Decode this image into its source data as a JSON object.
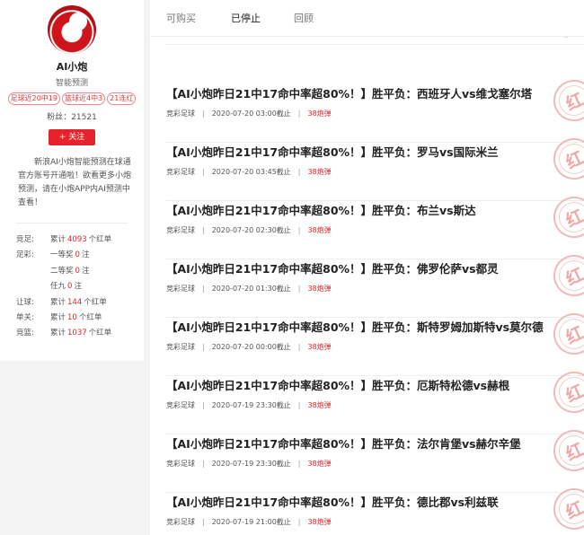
{
  "profile": {
    "name": "AI小炮",
    "subtitle": "智能预测",
    "badges": [
      "足球近20中19",
      "篮球近4中3",
      "21连红"
    ],
    "fans_label": "粉丝：",
    "fans": "21521",
    "follow_label": "+ 关注",
    "description": "新浪AI小炮智能预测在球通官方账号开通啦！欲看更多小炮预测，请在小炮APP内AI预测中查看！",
    "stats": [
      {
        "label": "竞足:",
        "prefix": "累计",
        "value": "4093",
        "suffix": "个红单"
      },
      {
        "label": "足彩:",
        "prefix": "一等奖",
        "value": "0",
        "suffix": "注"
      },
      {
        "label": "",
        "prefix": "二等奖",
        "value": "0",
        "suffix": "注"
      },
      {
        "label": "",
        "prefix": "任九",
        "value": "0",
        "suffix": "注"
      },
      {
        "label": "让球:",
        "prefix": "累计",
        "value": "144",
        "suffix": "个红单"
      },
      {
        "label": "单关:",
        "prefix": "累计",
        "value": "10",
        "suffix": "个红单"
      },
      {
        "label": "竞篮:",
        "prefix": "累计",
        "value": "1037",
        "suffix": "个红单"
      }
    ]
  },
  "tabs": [
    {
      "label": "可购买",
      "active": false
    },
    {
      "label": "已停止",
      "active": true
    },
    {
      "label": "回顾",
      "active": false
    }
  ],
  "stamp_text": "红",
  "items": [
    {
      "title": "",
      "category": "竞彩足球",
      "time": "2020-07-20 03:00截止",
      "price": "38炮弹"
    },
    {
      "title": "【AI小炮昨日21中17命中率超80%！】胜平负：西班牙人vs维戈塞尔塔",
      "category": "竞彩足球",
      "time": "2020-07-20 03:00截止",
      "price": "38炮弹"
    },
    {
      "title": "【AI小炮昨日21中17命中率超80%！】胜平负：罗马vs国际米兰",
      "category": "竞彩足球",
      "time": "2020-07-20 03:45截止",
      "price": "38炮弹"
    },
    {
      "title": "【AI小炮昨日21中17命中率超80%！】胜平负：布兰vs斯达",
      "category": "竞彩足球",
      "time": "2020-07-20 02:30截止",
      "price": "38炮弹"
    },
    {
      "title": "【AI小炮昨日21中17命中率超80%！】胜平负：佛罗伦萨vs都灵",
      "category": "竞彩足球",
      "time": "2020-07-20 01:30截止",
      "price": "38炮弹"
    },
    {
      "title": "【AI小炮昨日21中17命中率超80%！】胜平负：斯特罗姆加斯特vs莫尔德",
      "category": "竞彩足球",
      "time": "2020-07-20 00:00截止",
      "price": "38炮弹"
    },
    {
      "title": "【AI小炮昨日21中17命中率超80%！】胜平负：厄斯特松德vs赫根",
      "category": "竞彩足球",
      "time": "2020-07-19 23:30截止",
      "price": "38炮弹"
    },
    {
      "title": "【AI小炮昨日21中17命中率超80%！】胜平负：法尔肯堡vs赫尔辛堡",
      "category": "竞彩足球",
      "time": "2020-07-19 23:30截止",
      "price": "38炮弹"
    },
    {
      "title": "【AI小炮昨日21中17命中率超80%！】胜平负：德比郡vs利兹联",
      "category": "竞彩足球",
      "time": "2020-07-19 21:00截止",
      "price": "38炮弹"
    }
  ]
}
